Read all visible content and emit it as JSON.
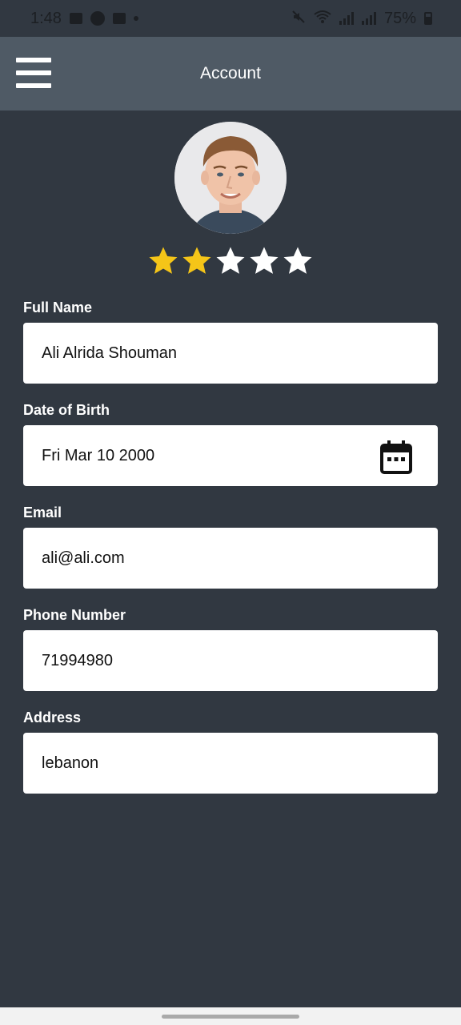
{
  "status_bar": {
    "time": "1:48",
    "battery": "75%",
    "left_icons": [
      "gallery-icon",
      "a-icon",
      "clipboard-icon",
      "dot-icon"
    ],
    "right_icons": [
      "mute-icon",
      "wifi-icon",
      "signal-icon",
      "signal-icon",
      "battery-icon"
    ]
  },
  "header": {
    "title": "Account",
    "menu_icon": "hamburger-menu-icon"
  },
  "profile": {
    "avatar_icon": "profile-photo",
    "rating": {
      "value": 2,
      "max": 5,
      "filled_color": "#f5c518",
      "empty_color": "#ffffff"
    }
  },
  "form": {
    "full_name": {
      "label": "Full Name",
      "value": "Ali Alrida Shouman"
    },
    "date_of_birth": {
      "label": "Date of Birth",
      "value": "Fri Mar 10 2000",
      "icon": "calendar-icon"
    },
    "email": {
      "label": "Email",
      "value": "ali@ali.com"
    },
    "phone": {
      "label": "Phone Number",
      "value": "71994980"
    },
    "address": {
      "label": "Address",
      "value": "lebanon"
    }
  },
  "colors": {
    "background": "#313841",
    "header": "#4f5a65",
    "field": "#ffffff"
  }
}
